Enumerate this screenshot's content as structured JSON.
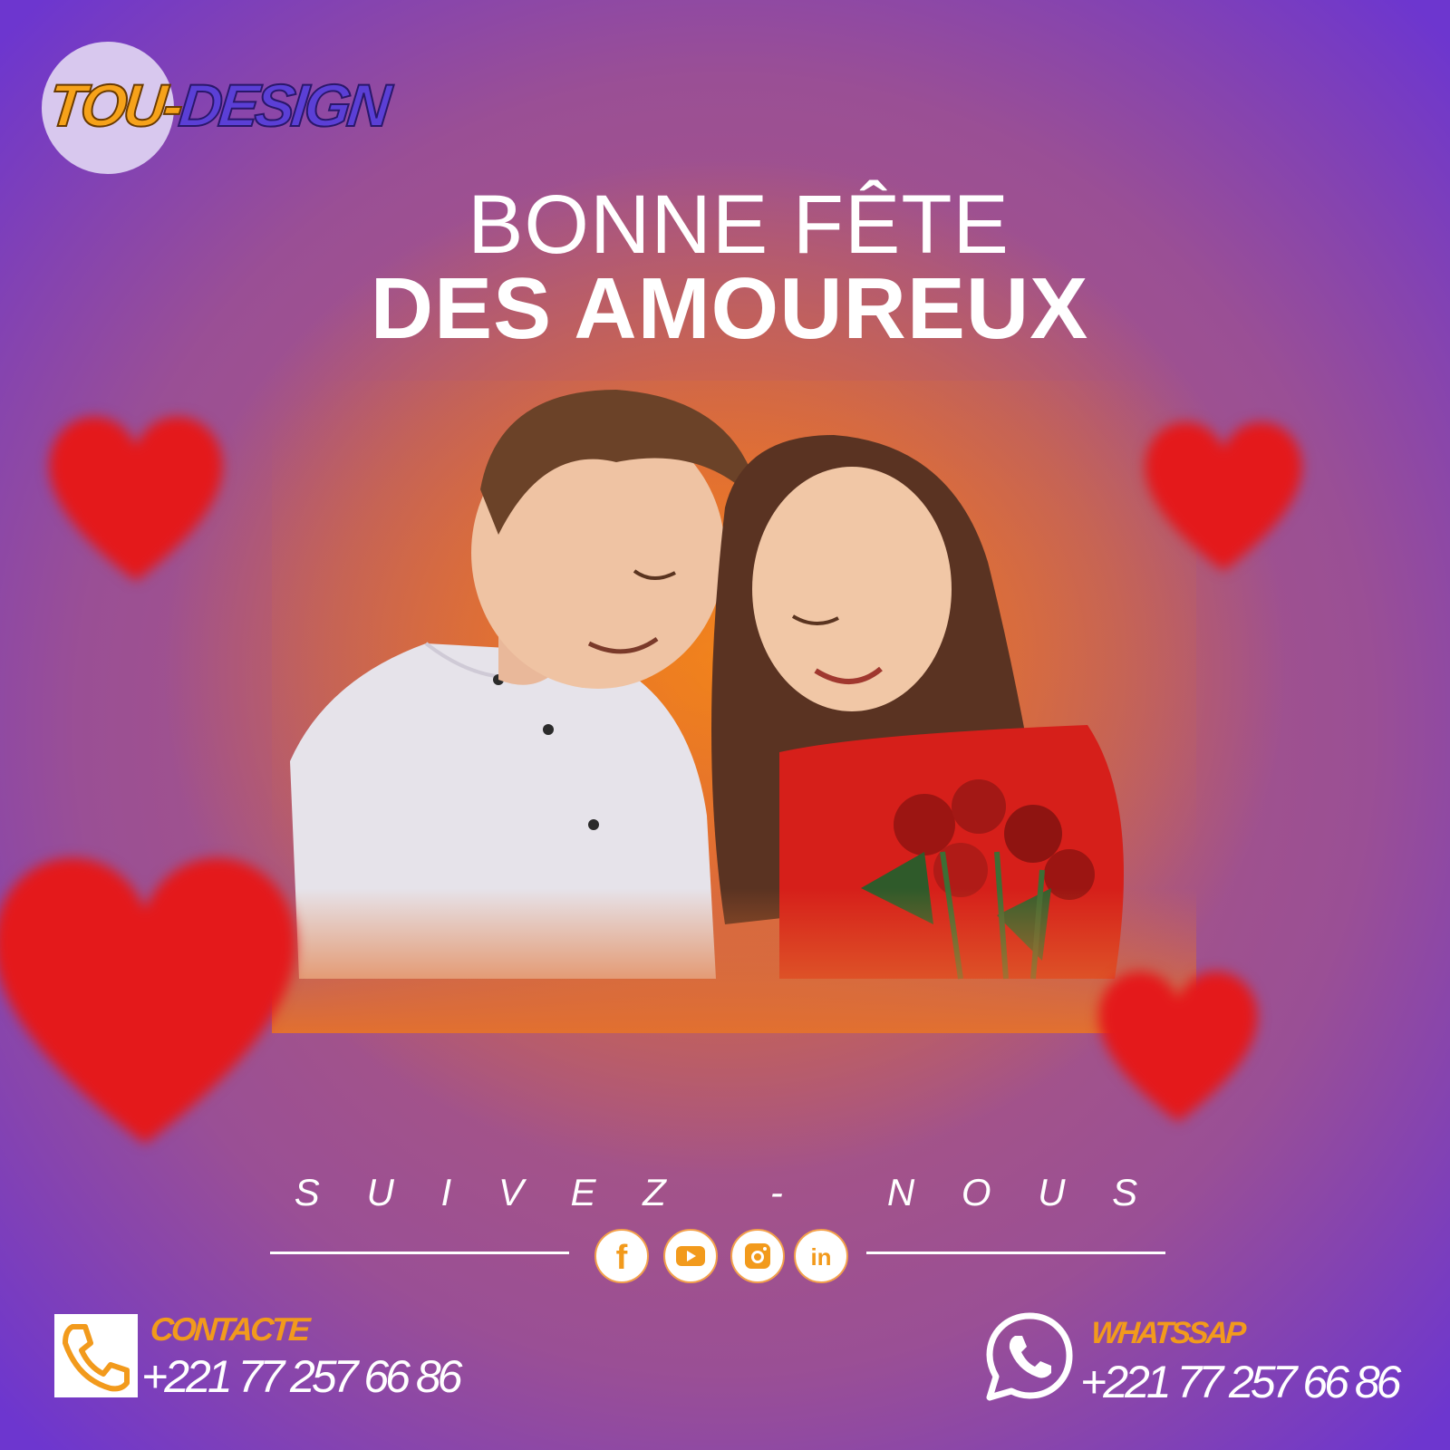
{
  "brand": {
    "part1": "TOU-",
    "part2": "DESIGN"
  },
  "headline": {
    "line1": "BONNE FÊTE",
    "line2": "DES AMOUREUX"
  },
  "follow": {
    "label": "S U I V E Z   -   N O U S"
  },
  "social": [
    "facebook-icon",
    "youtube-icon",
    "instagram-icon",
    "linkedin-icon"
  ],
  "social_text": {
    "facebook": "f",
    "linkedin": "in"
  },
  "contact": {
    "label": "CONTACTE",
    "phone": "+221 77 257 66 86"
  },
  "whatsapp": {
    "label": "WHATSSAP",
    "phone": "+221 77 257 66 86"
  },
  "colors": {
    "accent": "#f29a1c",
    "purple": "#6d36cf",
    "orange": "#ef7a1d",
    "heart": "#e4191b"
  }
}
